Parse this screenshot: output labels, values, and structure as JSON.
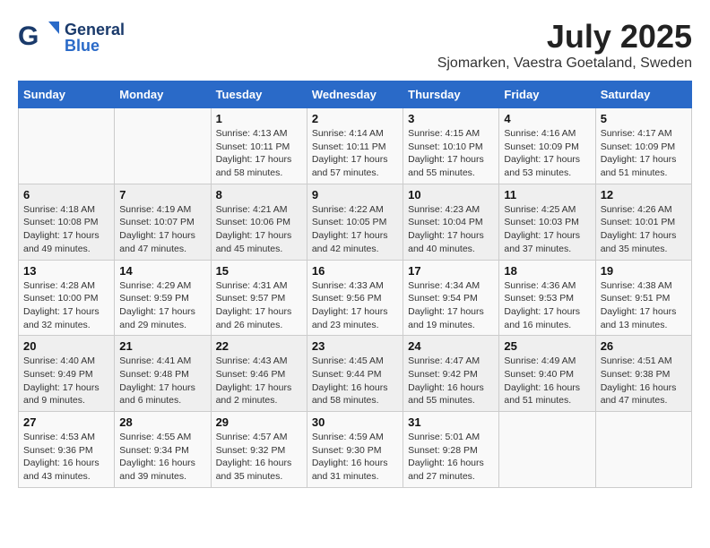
{
  "header": {
    "logo_line1": "General",
    "logo_line2": "Blue",
    "month": "July 2025",
    "location": "Sjomarken, Vaestra Goetaland, Sweden"
  },
  "weekdays": [
    "Sunday",
    "Monday",
    "Tuesday",
    "Wednesday",
    "Thursday",
    "Friday",
    "Saturday"
  ],
  "weeks": [
    [
      {
        "day": "",
        "info": ""
      },
      {
        "day": "",
        "info": ""
      },
      {
        "day": "1",
        "info": "Sunrise: 4:13 AM\nSunset: 10:11 PM\nDaylight: 17 hours\nand 58 minutes."
      },
      {
        "day": "2",
        "info": "Sunrise: 4:14 AM\nSunset: 10:11 PM\nDaylight: 17 hours\nand 57 minutes."
      },
      {
        "day": "3",
        "info": "Sunrise: 4:15 AM\nSunset: 10:10 PM\nDaylight: 17 hours\nand 55 minutes."
      },
      {
        "day": "4",
        "info": "Sunrise: 4:16 AM\nSunset: 10:09 PM\nDaylight: 17 hours\nand 53 minutes."
      },
      {
        "day": "5",
        "info": "Sunrise: 4:17 AM\nSunset: 10:09 PM\nDaylight: 17 hours\nand 51 minutes."
      }
    ],
    [
      {
        "day": "6",
        "info": "Sunrise: 4:18 AM\nSunset: 10:08 PM\nDaylight: 17 hours\nand 49 minutes."
      },
      {
        "day": "7",
        "info": "Sunrise: 4:19 AM\nSunset: 10:07 PM\nDaylight: 17 hours\nand 47 minutes."
      },
      {
        "day": "8",
        "info": "Sunrise: 4:21 AM\nSunset: 10:06 PM\nDaylight: 17 hours\nand 45 minutes."
      },
      {
        "day": "9",
        "info": "Sunrise: 4:22 AM\nSunset: 10:05 PM\nDaylight: 17 hours\nand 42 minutes."
      },
      {
        "day": "10",
        "info": "Sunrise: 4:23 AM\nSunset: 10:04 PM\nDaylight: 17 hours\nand 40 minutes."
      },
      {
        "day": "11",
        "info": "Sunrise: 4:25 AM\nSunset: 10:03 PM\nDaylight: 17 hours\nand 37 minutes."
      },
      {
        "day": "12",
        "info": "Sunrise: 4:26 AM\nSunset: 10:01 PM\nDaylight: 17 hours\nand 35 minutes."
      }
    ],
    [
      {
        "day": "13",
        "info": "Sunrise: 4:28 AM\nSunset: 10:00 PM\nDaylight: 17 hours\nand 32 minutes."
      },
      {
        "day": "14",
        "info": "Sunrise: 4:29 AM\nSunset: 9:59 PM\nDaylight: 17 hours\nand 29 minutes."
      },
      {
        "day": "15",
        "info": "Sunrise: 4:31 AM\nSunset: 9:57 PM\nDaylight: 17 hours\nand 26 minutes."
      },
      {
        "day": "16",
        "info": "Sunrise: 4:33 AM\nSunset: 9:56 PM\nDaylight: 17 hours\nand 23 minutes."
      },
      {
        "day": "17",
        "info": "Sunrise: 4:34 AM\nSunset: 9:54 PM\nDaylight: 17 hours\nand 19 minutes."
      },
      {
        "day": "18",
        "info": "Sunrise: 4:36 AM\nSunset: 9:53 PM\nDaylight: 17 hours\nand 16 minutes."
      },
      {
        "day": "19",
        "info": "Sunrise: 4:38 AM\nSunset: 9:51 PM\nDaylight: 17 hours\nand 13 minutes."
      }
    ],
    [
      {
        "day": "20",
        "info": "Sunrise: 4:40 AM\nSunset: 9:49 PM\nDaylight: 17 hours\nand 9 minutes."
      },
      {
        "day": "21",
        "info": "Sunrise: 4:41 AM\nSunset: 9:48 PM\nDaylight: 17 hours\nand 6 minutes."
      },
      {
        "day": "22",
        "info": "Sunrise: 4:43 AM\nSunset: 9:46 PM\nDaylight: 17 hours\nand 2 minutes."
      },
      {
        "day": "23",
        "info": "Sunrise: 4:45 AM\nSunset: 9:44 PM\nDaylight: 16 hours\nand 58 minutes."
      },
      {
        "day": "24",
        "info": "Sunrise: 4:47 AM\nSunset: 9:42 PM\nDaylight: 16 hours\nand 55 minutes."
      },
      {
        "day": "25",
        "info": "Sunrise: 4:49 AM\nSunset: 9:40 PM\nDaylight: 16 hours\nand 51 minutes."
      },
      {
        "day": "26",
        "info": "Sunrise: 4:51 AM\nSunset: 9:38 PM\nDaylight: 16 hours\nand 47 minutes."
      }
    ],
    [
      {
        "day": "27",
        "info": "Sunrise: 4:53 AM\nSunset: 9:36 PM\nDaylight: 16 hours\nand 43 minutes."
      },
      {
        "day": "28",
        "info": "Sunrise: 4:55 AM\nSunset: 9:34 PM\nDaylight: 16 hours\nand 39 minutes."
      },
      {
        "day": "29",
        "info": "Sunrise: 4:57 AM\nSunset: 9:32 PM\nDaylight: 16 hours\nand 35 minutes."
      },
      {
        "day": "30",
        "info": "Sunrise: 4:59 AM\nSunset: 9:30 PM\nDaylight: 16 hours\nand 31 minutes."
      },
      {
        "day": "31",
        "info": "Sunrise: 5:01 AM\nSunset: 9:28 PM\nDaylight: 16 hours\nand 27 minutes."
      },
      {
        "day": "",
        "info": ""
      },
      {
        "day": "",
        "info": ""
      }
    ]
  ]
}
